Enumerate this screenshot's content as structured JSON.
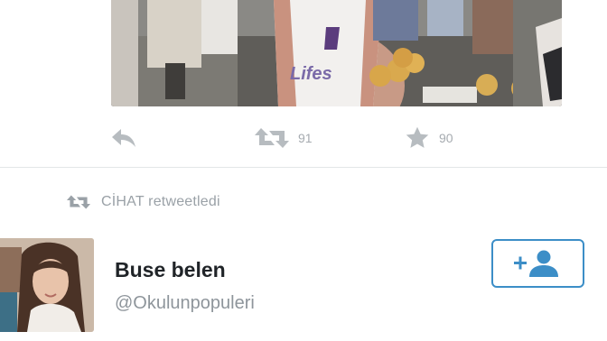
{
  "tweet": {
    "media": {
      "description_icon": "photo-icon"
    },
    "actions": {
      "reply_icon": "reply-icon",
      "retweet_icon": "retweet-icon",
      "retweet_count": "91",
      "favorite_icon": "star-icon",
      "favorite_count": "90"
    }
  },
  "retweet_context": {
    "icon": "retweet-icon",
    "text": "CİHAT retweetledi"
  },
  "user": {
    "name": "Buse belen",
    "handle": "@Okulunpopuleri",
    "follow_icon": "add-user-icon"
  },
  "colors": {
    "accent": "#3c8ec7",
    "icon_gray": "#b7bcc0",
    "text_dark": "#202428",
    "text_muted": "#8e959b"
  }
}
